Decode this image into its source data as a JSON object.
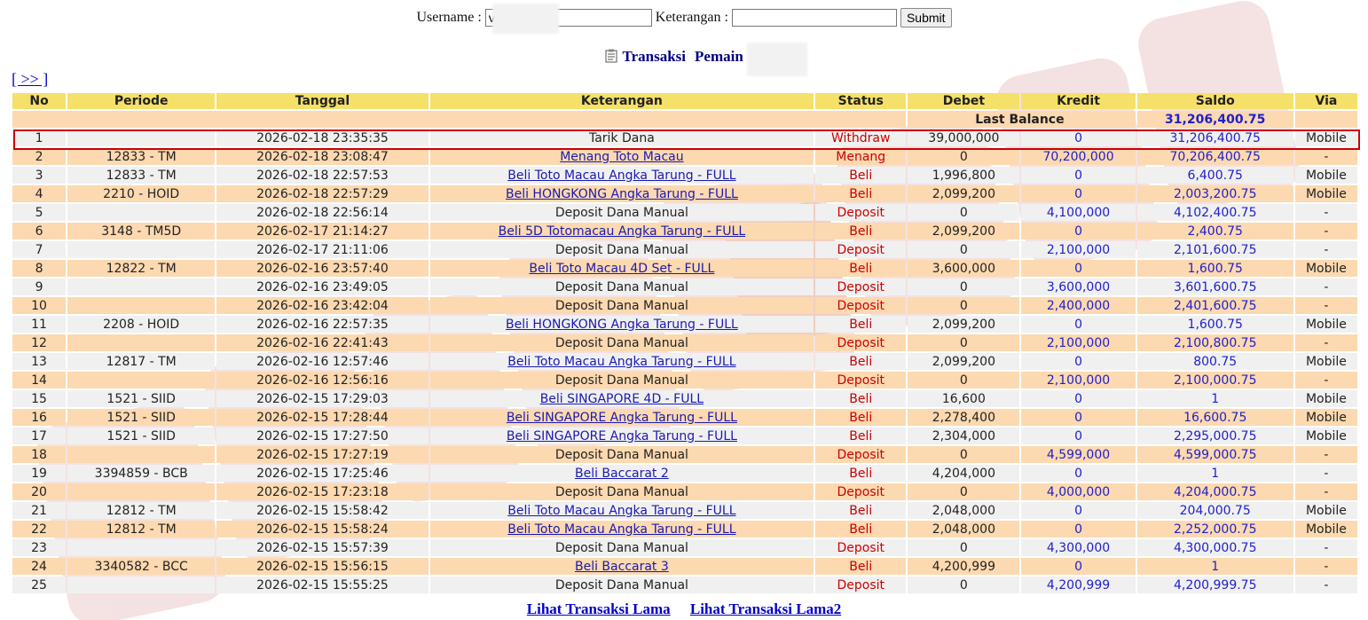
{
  "form": {
    "username_label": "Username :",
    "username_value": "v",
    "keterangan_label": "Keterangan :",
    "keterangan_value": "",
    "submit_label": "Submit"
  },
  "title": {
    "transaksi": "Transaksi",
    "pemain": "Pemain : v"
  },
  "nav": {
    "next": "[ >> ]"
  },
  "table": {
    "headers": [
      "No",
      "Periode",
      "Tanggal",
      "Keterangan",
      "Status",
      "Debet",
      "Kredit",
      "Saldo",
      "Via"
    ],
    "last_balance_label": "Last Balance",
    "last_balance_value": "31,206,400.75",
    "rows": [
      {
        "no": "1",
        "periode": "",
        "tanggal": "2026-02-18 23:35:35",
        "ket": "Tarik Dana",
        "link": false,
        "status": "Withdraw",
        "debet": "39,000,000",
        "kredit": "0",
        "saldo": "31,206,400.75",
        "via": "Mobile"
      },
      {
        "no": "2",
        "periode": "12833 - TM",
        "tanggal": "2026-02-18 23:08:47",
        "ket": "Menang Toto Macau",
        "link": true,
        "status": "Menang",
        "debet": "0",
        "kredit": "70,200,000",
        "saldo": "70,206,400.75",
        "via": "-"
      },
      {
        "no": "3",
        "periode": "12833 - TM",
        "tanggal": "2026-02-18 22:57:53",
        "ket": "Beli Toto Macau Angka Tarung - FULL",
        "link": true,
        "status": "Beli",
        "debet": "1,996,800",
        "kredit": "0",
        "saldo": "6,400.75",
        "via": "Mobile"
      },
      {
        "no": "4",
        "periode": "2210 - HOID",
        "tanggal": "2026-02-18 22:57:29",
        "ket": "Beli HONGKONG Angka Tarung - FULL",
        "link": true,
        "status": "Beli",
        "debet": "2,099,200",
        "kredit": "0",
        "saldo": "2,003,200.75",
        "via": "Mobile"
      },
      {
        "no": "5",
        "periode": "",
        "tanggal": "2026-02-18 22:56:14",
        "ket": "Deposit Dana Manual",
        "link": false,
        "status": "Deposit",
        "debet": "0",
        "kredit": "4,100,000",
        "saldo": "4,102,400.75",
        "via": "-"
      },
      {
        "no": "6",
        "periode": "3148 - TM5D",
        "tanggal": "2026-02-17 21:14:27",
        "ket": "Beli 5D Totomacau Angka Tarung - FULL",
        "link": true,
        "status": "Beli",
        "debet": "2,099,200",
        "kredit": "0",
        "saldo": "2,400.75",
        "via": "-"
      },
      {
        "no": "7",
        "periode": "",
        "tanggal": "2026-02-17 21:11:06",
        "ket": "Deposit Dana Manual",
        "link": false,
        "status": "Deposit",
        "debet": "0",
        "kredit": "2,100,000",
        "saldo": "2,101,600.75",
        "via": "-"
      },
      {
        "no": "8",
        "periode": "12822 - TM",
        "tanggal": "2026-02-16 23:57:40",
        "ket": "Beli Toto Macau 4D Set - FULL",
        "link": true,
        "status": "Beli",
        "debet": "3,600,000",
        "kredit": "0",
        "saldo": "1,600.75",
        "via": "Mobile"
      },
      {
        "no": "9",
        "periode": "",
        "tanggal": "2026-02-16 23:49:05",
        "ket": "Deposit Dana Manual",
        "link": false,
        "status": "Deposit",
        "debet": "0",
        "kredit": "3,600,000",
        "saldo": "3,601,600.75",
        "via": "-"
      },
      {
        "no": "10",
        "periode": "",
        "tanggal": "2026-02-16 23:42:04",
        "ket": "Deposit Dana Manual",
        "link": false,
        "status": "Deposit",
        "debet": "0",
        "kredit": "2,400,000",
        "saldo": "2,401,600.75",
        "via": "-"
      },
      {
        "no": "11",
        "periode": "2208 - HOID",
        "tanggal": "2026-02-16 22:57:35",
        "ket": "Beli HONGKONG Angka Tarung - FULL",
        "link": true,
        "status": "Beli",
        "debet": "2,099,200",
        "kredit": "0",
        "saldo": "1,600.75",
        "via": "Mobile"
      },
      {
        "no": "12",
        "periode": "",
        "tanggal": "2026-02-16 22:41:43",
        "ket": "Deposit Dana Manual",
        "link": false,
        "status": "Deposit",
        "debet": "0",
        "kredit": "2,100,000",
        "saldo": "2,100,800.75",
        "via": "-"
      },
      {
        "no": "13",
        "periode": "12817 - TM",
        "tanggal": "2026-02-16 12:57:46",
        "ket": "Beli Toto Macau Angka Tarung - FULL",
        "link": true,
        "status": "Beli",
        "debet": "2,099,200",
        "kredit": "0",
        "saldo": "800.75",
        "via": "Mobile"
      },
      {
        "no": "14",
        "periode": "",
        "tanggal": "2026-02-16 12:56:16",
        "ket": "Deposit Dana Manual",
        "link": false,
        "status": "Deposit",
        "debet": "0",
        "kredit": "2,100,000",
        "saldo": "2,100,000.75",
        "via": "-"
      },
      {
        "no": "15",
        "periode": "1521 - SIID",
        "tanggal": "2026-02-15 17:29:03",
        "ket": "Beli SINGAPORE 4D - FULL",
        "link": true,
        "status": "Beli",
        "debet": "16,600",
        "kredit": "0",
        "saldo": "1",
        "via": "Mobile"
      },
      {
        "no": "16",
        "periode": "1521 - SIID",
        "tanggal": "2026-02-15 17:28:44",
        "ket": "Beli SINGAPORE Angka Tarung - FULL",
        "link": true,
        "status": "Beli",
        "debet": "2,278,400",
        "kredit": "0",
        "saldo": "16,600.75",
        "via": "Mobile"
      },
      {
        "no": "17",
        "periode": "1521 - SIID",
        "tanggal": "2026-02-15 17:27:50",
        "ket": "Beli SINGAPORE Angka Tarung - FULL",
        "link": true,
        "status": "Beli",
        "debet": "2,304,000",
        "kredit": "0",
        "saldo": "2,295,000.75",
        "via": "Mobile"
      },
      {
        "no": "18",
        "periode": "",
        "tanggal": "2026-02-15 17:27:19",
        "ket": "Deposit Dana Manual",
        "link": false,
        "status": "Deposit",
        "debet": "0",
        "kredit": "4,599,000",
        "saldo": "4,599,000.75",
        "via": "-"
      },
      {
        "no": "19",
        "periode": "3394859 - BCB",
        "tanggal": "2026-02-15 17:25:46",
        "ket": "Beli Baccarat 2",
        "link": true,
        "status": "Beli",
        "debet": "4,204,000",
        "kredit": "0",
        "saldo": "1",
        "via": "-"
      },
      {
        "no": "20",
        "periode": "",
        "tanggal": "2026-02-15 17:23:18",
        "ket": "Deposit Dana Manual",
        "link": false,
        "status": "Deposit",
        "debet": "0",
        "kredit": "4,000,000",
        "saldo": "4,204,000.75",
        "via": "-"
      },
      {
        "no": "21",
        "periode": "12812 - TM",
        "tanggal": "2026-02-15 15:58:42",
        "ket": "Beli Toto Macau Angka Tarung - FULL",
        "link": true,
        "status": "Beli",
        "debet": "2,048,000",
        "kredit": "0",
        "saldo": "204,000.75",
        "via": "Mobile"
      },
      {
        "no": "22",
        "periode": "12812 - TM",
        "tanggal": "2026-02-15 15:58:24",
        "ket": "Beli Toto Macau Angka Tarung - FULL",
        "link": true,
        "status": "Beli",
        "debet": "2,048,000",
        "kredit": "0",
        "saldo": "2,252,000.75",
        "via": "Mobile"
      },
      {
        "no": "23",
        "periode": "",
        "tanggal": "2026-02-15 15:57:39",
        "ket": "Deposit Dana Manual",
        "link": false,
        "status": "Deposit",
        "debet": "0",
        "kredit": "4,300,000",
        "saldo": "4,300,000.75",
        "via": "-"
      },
      {
        "no": "24",
        "periode": "3340582 - BCC",
        "tanggal": "2026-02-15 15:56:15",
        "ket": "Beli Baccarat 3",
        "link": true,
        "status": "Beli",
        "debet": "4,200,999",
        "kredit": "0",
        "saldo": "1",
        "via": "-"
      },
      {
        "no": "25",
        "periode": "",
        "tanggal": "2026-02-15 15:55:25",
        "ket": "Deposit Dana Manual",
        "link": false,
        "status": "Deposit",
        "debet": "0",
        "kredit": "4,200,999",
        "saldo": "4,200,999.75",
        "via": "-"
      }
    ]
  },
  "footer": {
    "link1": "Lihat Transaksi Lama",
    "link2": "Lihat Transaksi Lama2"
  },
  "colors": {
    "header_bg": "#f5e06a",
    "row_odd": "#f0f0f0",
    "row_even": "#fcd9b0",
    "status_red": "#cc0000",
    "blue_values": "#2020cc",
    "highlight_border": "#cc0000"
  },
  "icons": {
    "title_icon": "clipboard-icon"
  }
}
